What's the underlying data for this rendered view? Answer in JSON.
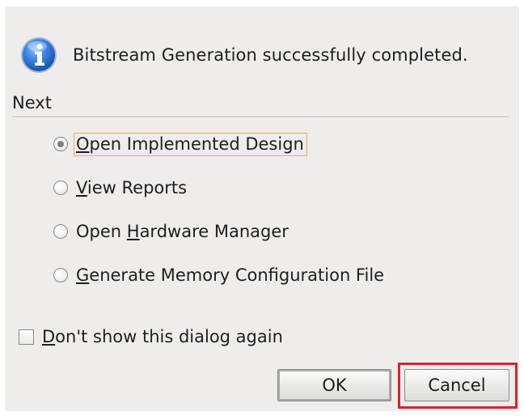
{
  "dialog": {
    "message": "Bitstream Generation successfully completed.",
    "icon": "info-icon",
    "section_label": "Next",
    "options": [
      {
        "label": "Open Implemented Design",
        "checked": true,
        "focused": true
      },
      {
        "label": "View Reports",
        "checked": false,
        "focused": false
      },
      {
        "label": "Open Hardware Manager",
        "checked": false,
        "focused": false
      },
      {
        "label": "Generate Memory Configuration File",
        "checked": false,
        "focused": false
      }
    ],
    "dont_show_label": "Don't show this dialog again",
    "dont_show_checked": false,
    "ok_label": "OK",
    "cancel_label": "Cancel"
  },
  "colors": {
    "dialog_bg": "#eeedec",
    "info_icon_blue": "#1f63c6",
    "focus_border": "#e0b253",
    "highlight_red": "#d8232a"
  }
}
